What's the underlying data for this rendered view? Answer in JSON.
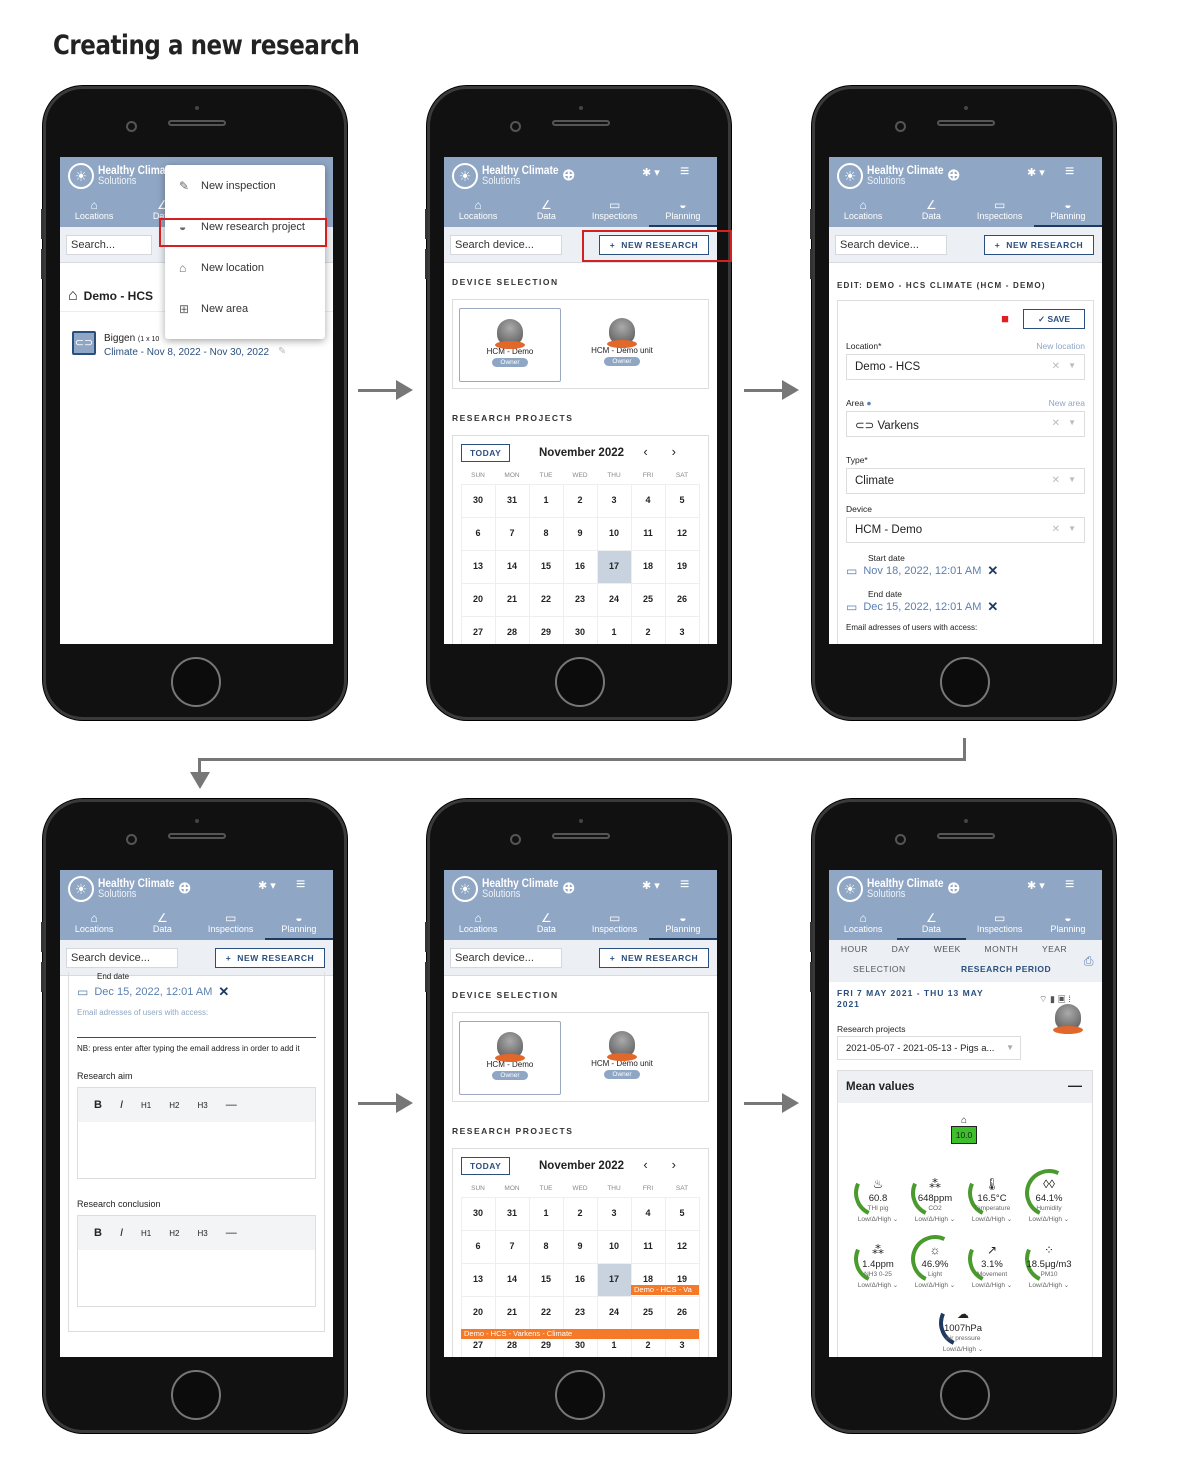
{
  "page_title": "Creating a new research",
  "brand": {
    "name": "Healthy Climate",
    "sub": "Solutions"
  },
  "nav": [
    "Locations",
    "Data",
    "Inspections",
    "Planning"
  ],
  "phone1": {
    "search": "Search...",
    "menu": [
      "New inspection",
      "New research project",
      "New location",
      "New area"
    ],
    "location_title": "Demo - HCS",
    "area_name": "Biggen",
    "area_dims": "(1 x 10",
    "research_line": "Climate - Nov 8, 2022 - Nov 30, 2022"
  },
  "common": {
    "search_device": "Search device...",
    "new_research": "NEW RESEARCH",
    "device_selection": "DEVICE SELECTION",
    "research_projects": "RESEARCH PROJECTS",
    "devices": [
      {
        "name": "HCM - Demo",
        "badge": "Owner"
      },
      {
        "name": "HCM - Demo unit",
        "badge": "Owner"
      }
    ],
    "today": "TODAY",
    "month": "November 2022",
    "weekdays": [
      "SUN",
      "MON",
      "TUE",
      "WED",
      "THU",
      "FRI",
      "SAT"
    ],
    "weeks": [
      [
        "30",
        "31",
        "1",
        "2",
        "3",
        "4",
        "5"
      ],
      [
        "6",
        "7",
        "8",
        "9",
        "10",
        "11",
        "12"
      ],
      [
        "13",
        "14",
        "15",
        "16",
        "17",
        "18",
        "19"
      ],
      [
        "20",
        "21",
        "22",
        "23",
        "24",
        "25",
        "26"
      ],
      [
        "27",
        "28",
        "29",
        "30",
        "1",
        "2",
        "3"
      ]
    ]
  },
  "phone3": {
    "title": "EDIT: DEMO - HCS CLIMATE (HCM - DEMO)",
    "save": "SAVE",
    "location_label": "Location*",
    "new_location": "New location",
    "location_value": "Demo - HCS",
    "area_label": "Area",
    "new_area": "New area",
    "area_value": "Varkens",
    "type_label": "Type*",
    "type_value": "Climate",
    "device_label": "Device",
    "device_value": "HCM - Demo",
    "start_label": "Start date",
    "start_value": "Nov 18, 2022, 12:01 AM",
    "end_label": "End date",
    "end_value": "Dec 15, 2022, 12:01 AM",
    "email_cut": "Email adresses of users with access:"
  },
  "phone4": {
    "end_label": "End date",
    "end_value": "Dec 15, 2022, 12:01 AM",
    "email_label": "Email adresses of users with access:",
    "note": "NB: press enter after typing the email address in order to add it",
    "aim": "Research aim",
    "conclusion": "Research conclusion",
    "toolbar": [
      "B",
      "I",
      "H1",
      "H2",
      "H3",
      "—"
    ]
  },
  "phone5": {
    "event1": "Demo - HCS - Va",
    "event2": "Demo - HCS - Varkens - Climate"
  },
  "phone6": {
    "periods": [
      "HOUR",
      "DAY",
      "WEEK",
      "MONTH",
      "YEAR"
    ],
    "selection": "SELECTION",
    "research_period": "RESEARCH PERIOD",
    "range": "FRI 7 MAY 2021 - THU 13 MAY 2021",
    "rp_label": "Research projects",
    "rp_value": "2021-05-07 - 2021-05-13 - Pigs a...",
    "mean": "Mean values",
    "score": "10.0",
    "gauges": [
      {
        "v": "60.8",
        "l": "THI pig"
      },
      {
        "v": "648ppm",
        "l": "CO2"
      },
      {
        "v": "16.5°C",
        "l": "Temperature"
      },
      {
        "v": "64.1%",
        "l": "Humidity"
      },
      {
        "v": "1.4ppm",
        "l": "NH3 0-25"
      },
      {
        "v": "46.9%",
        "l": "Light"
      },
      {
        "v": "3.1%",
        "l": "Movement"
      },
      {
        "v": "18.5μg/m3",
        "l": "PM10"
      },
      {
        "v": "1007hPa",
        "l": "Air pressure"
      }
    ],
    "lowhigh": "Low/Δ/High ⌄"
  },
  "colors": {
    "header": "#8fa6c4",
    "accent": "#2a4f7e",
    "event": "#f47a2a",
    "highlight": "#d42020",
    "gauge_green": "#4a9a2e"
  }
}
